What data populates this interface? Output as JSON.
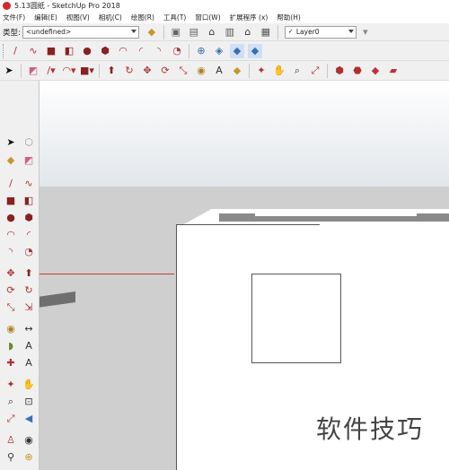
{
  "title_bar": {
    "title": "5.13圆纸 - SketchUp Pro 2018"
  },
  "menu": [
    "文件(F)",
    "编辑(E)",
    "视图(V)",
    "相机(C)",
    "绘图(R)",
    "工具(T)",
    "窗口(W)",
    "扩展程序 (x)",
    "帮助(H)"
  ],
  "style_bar": {
    "label": "类型:",
    "style_value": "<undefined>",
    "layer_value": "Layer0"
  },
  "colors": {
    "toolbar_bg": "#f0f0f0",
    "ground": "#cfcfcf",
    "axis_red": "#c83a3a",
    "app_icon": "#d8242c"
  },
  "watermark": "软件技巧"
}
